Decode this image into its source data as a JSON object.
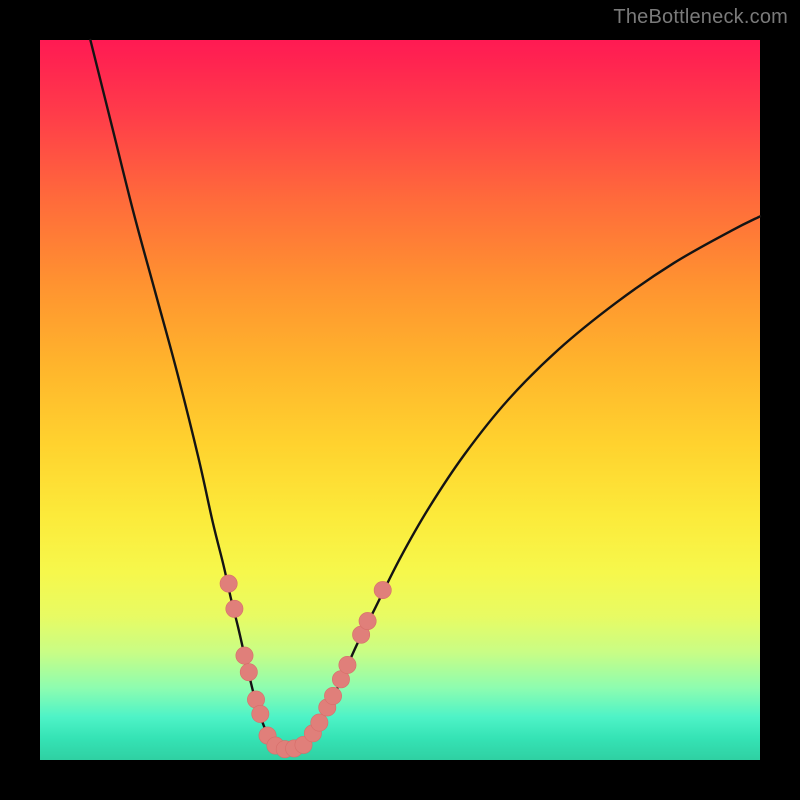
{
  "watermark": "TheBottleneck.com",
  "colors": {
    "page_bg": "#000000",
    "gradient_top": "#ff1a53",
    "gradient_bottom": "#2fd0a2",
    "curve": "#141414",
    "dot_fill": "#e07f7a",
    "dot_stroke": "#d76e6a"
  },
  "chart_data": {
    "type": "line",
    "title": "",
    "xlabel": "",
    "ylabel": "",
    "xlim": [
      0,
      100
    ],
    "ylim": [
      0,
      100
    ],
    "grid": false,
    "legend": false,
    "note": "Bottleneck-style V-curve. Axes are 0–100 percent domains; values estimated from pixel positions (origin bottom-left).",
    "series": [
      {
        "name": "left-branch",
        "x": [
          7,
          10,
          13,
          16,
          19,
          22,
          24,
          25.5,
          26.5,
          27.5,
          28.3,
          29,
          29.6,
          30.2,
          30.8,
          31.5,
          32.3
        ],
        "y": [
          100,
          88,
          76,
          65,
          54,
          42,
          33,
          27,
          22.5,
          18.5,
          15,
          12,
          9.5,
          7.5,
          5.5,
          3.8,
          2.3
        ]
      },
      {
        "name": "valley",
        "x": [
          32.3,
          33.3,
          34.5,
          35.8,
          37
        ],
        "y": [
          2.3,
          1.7,
          1.5,
          1.7,
          2.3
        ]
      },
      {
        "name": "right-branch",
        "x": [
          37,
          38,
          39.2,
          40.5,
          42,
          44,
          46.5,
          50,
          54,
          59,
          65,
          72,
          80,
          88,
          96,
          100
        ],
        "y": [
          2.3,
          3.8,
          5.8,
          8.3,
          11.5,
          16,
          21,
          28,
          35,
          42.5,
          50,
          57,
          63.5,
          69,
          73.5,
          75.5
        ]
      }
    ],
    "markers": {
      "name": "highlight-dots",
      "style": "circle",
      "radius_percent": 1.2,
      "points": [
        {
          "x": 26.2,
          "y": 24.5
        },
        {
          "x": 27.0,
          "y": 21.0
        },
        {
          "x": 28.4,
          "y": 14.5
        },
        {
          "x": 29.0,
          "y": 12.2
        },
        {
          "x": 30.0,
          "y": 8.4
        },
        {
          "x": 30.6,
          "y": 6.4
        },
        {
          "x": 31.6,
          "y": 3.4
        },
        {
          "x": 32.7,
          "y": 2.0
        },
        {
          "x": 34.0,
          "y": 1.5
        },
        {
          "x": 35.3,
          "y": 1.6
        },
        {
          "x": 36.6,
          "y": 2.1
        },
        {
          "x": 37.9,
          "y": 3.7
        },
        {
          "x": 38.8,
          "y": 5.2
        },
        {
          "x": 39.9,
          "y": 7.3
        },
        {
          "x": 40.7,
          "y": 8.9
        },
        {
          "x": 41.8,
          "y": 11.2
        },
        {
          "x": 42.7,
          "y": 13.2
        },
        {
          "x": 44.6,
          "y": 17.4
        },
        {
          "x": 45.5,
          "y": 19.3
        },
        {
          "x": 47.6,
          "y": 23.6
        }
      ]
    }
  }
}
